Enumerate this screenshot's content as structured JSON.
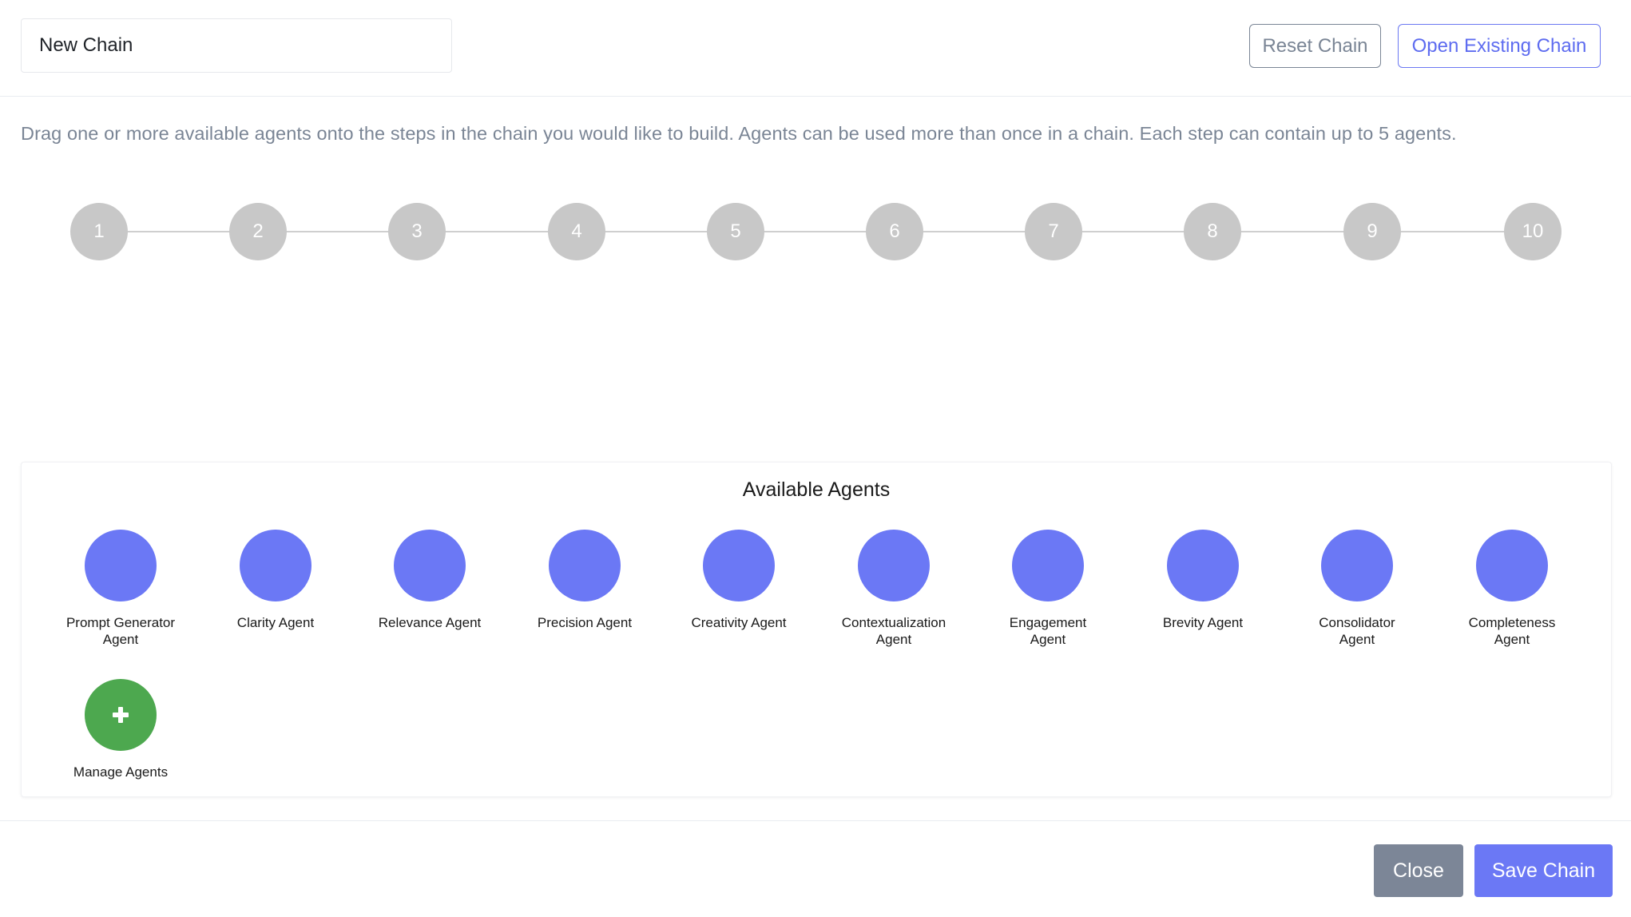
{
  "header": {
    "chain_name": "New Chain",
    "reset_label": "Reset Chain",
    "open_label": "Open Existing Chain"
  },
  "instructions": "Drag one or more available agents onto the steps in the chain you would like to build. Agents can be used more than once in a chain. Each step can contain up to 5 agents.",
  "steps": [
    "1",
    "2",
    "3",
    "4",
    "5",
    "6",
    "7",
    "8",
    "9",
    "10"
  ],
  "agents_panel": {
    "title": "Available Agents",
    "agents": [
      {
        "line1": "Prompt Generator",
        "line2": "Agent"
      },
      {
        "line1": "Clarity Agent",
        "line2": ""
      },
      {
        "line1": "Relevance Agent",
        "line2": ""
      },
      {
        "line1": "Precision Agent",
        "line2": ""
      },
      {
        "line1": "Creativity Agent",
        "line2": ""
      },
      {
        "line1": "Contextualization",
        "line2": "Agent"
      },
      {
        "line1": "Engagement",
        "line2": "Agent"
      },
      {
        "line1": "Brevity Agent",
        "line2": ""
      },
      {
        "line1": "Consolidator",
        "line2": "Agent"
      },
      {
        "line1": "Completeness",
        "line2": "Agent"
      }
    ],
    "manage_label": "Manage Agents",
    "manage_icon": "plus-icon"
  },
  "footer": {
    "close_label": "Close",
    "save_label": "Save Chain"
  },
  "colors": {
    "accent": "#6b78f5",
    "step_circle": "#c8c8c8",
    "manage_green": "#4da84f",
    "close_gray": "#7c8697",
    "muted_text": "#7a8595"
  }
}
